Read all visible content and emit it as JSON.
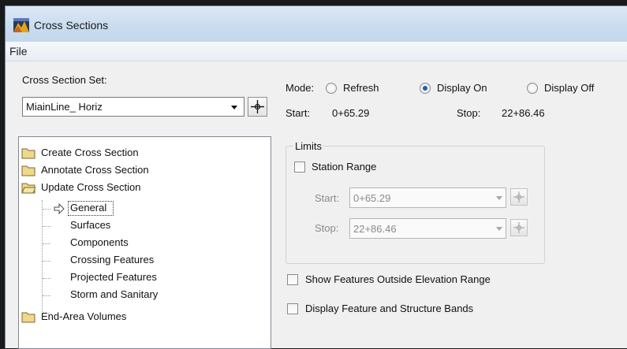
{
  "window": {
    "title": "Cross Sections"
  },
  "menu": {
    "file": "File"
  },
  "section_set": {
    "label": "Cross Section Set:",
    "value": "MiainLine_ Horiz"
  },
  "mode": {
    "label": "Mode:",
    "options": [
      "Refresh",
      "Display On",
      "Display Off"
    ],
    "selected": "Display On"
  },
  "range": {
    "start_label": "Start:",
    "start_value": "0+65.29",
    "stop_label": "Stop:",
    "stop_value": "22+86.46"
  },
  "tree": {
    "create": "Create Cross Section",
    "annotate": "Annotate Cross Section",
    "update": "Update Cross Section",
    "children": [
      "General",
      "Surfaces",
      "Components",
      "Crossing Features",
      "Projected Features",
      "Storm and Sanitary"
    ],
    "selected_child": "General",
    "end_area": "End-Area Volumes"
  },
  "limits": {
    "title": "Limits",
    "station_range": "Station Range",
    "station_range_checked": false,
    "start_label": "Start:",
    "start_value": "0+65.29",
    "stop_label": "Stop:",
    "stop_value": "22+86.46"
  },
  "options": {
    "show_outside": "Show Features Outside Elevation Range",
    "show_outside_checked": false,
    "display_bands": "Display Feature and Structure Bands",
    "display_bands_checked": false
  },
  "icons": [
    "app-icon",
    "folder-icon",
    "folder-open-icon",
    "arrow-right-icon",
    "target-icon",
    "dropdown-arrow-icon"
  ]
}
